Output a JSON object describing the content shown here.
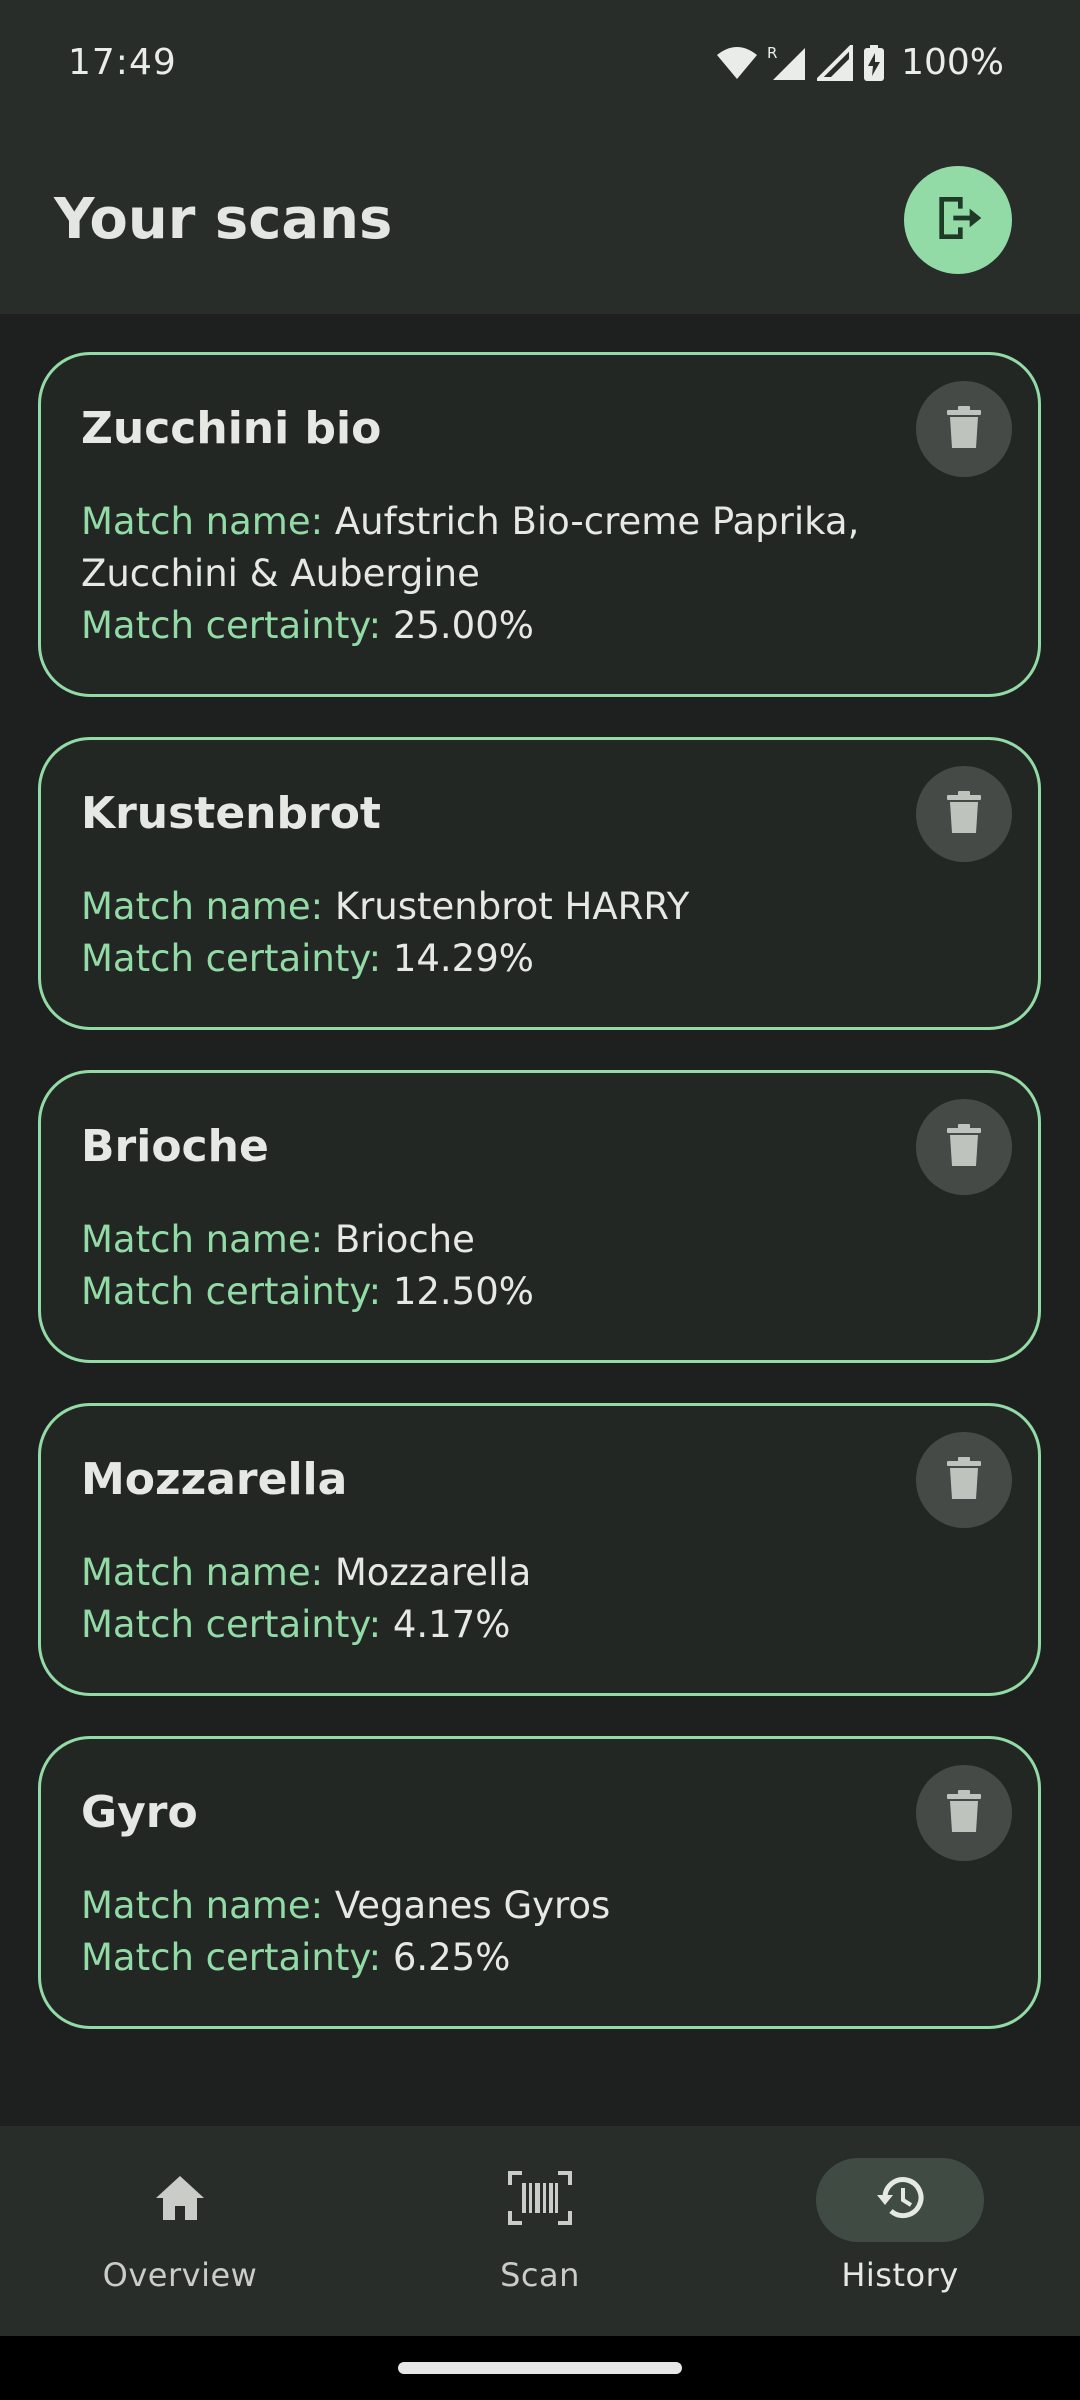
{
  "status_bar": {
    "time": "17:49",
    "battery": "100%",
    "icons": [
      "wifi-icon",
      "signal-roaming-icon",
      "signal-icon",
      "battery-charging-icon"
    ]
  },
  "header": {
    "title": "Your scans",
    "logout_icon": "logout-icon"
  },
  "labels": {
    "match_name": "Match name:",
    "match_certainty": "Match certainty:"
  },
  "scans": [
    {
      "title": "Zucchini bio",
      "match_name": "Aufstrich Bio-creme Paprika, Zucchini & Aubergine",
      "certainty": "25.00%"
    },
    {
      "title": "Krustenbrot",
      "match_name": "Krustenbrot HARRY",
      "certainty": "14.29%"
    },
    {
      "title": "Brioche",
      "match_name": "Brioche",
      "certainty": "12.50%"
    },
    {
      "title": "Mozzarella",
      "match_name": "Mozzarella",
      "certainty": "4.17%"
    },
    {
      "title": "Gyro",
      "match_name": "Veganes Gyros",
      "certainty": "6.25%"
    }
  ],
  "nav": {
    "items": [
      {
        "label": "Overview",
        "icon": "home-icon",
        "active": false
      },
      {
        "label": "Scan",
        "icon": "barcode-scan-icon",
        "active": false
      },
      {
        "label": "History",
        "icon": "history-icon",
        "active": true
      }
    ]
  },
  "colors": {
    "accent": "#93dba6",
    "background": "#1d201e",
    "surface": "#292d2a",
    "card": "#232724"
  }
}
